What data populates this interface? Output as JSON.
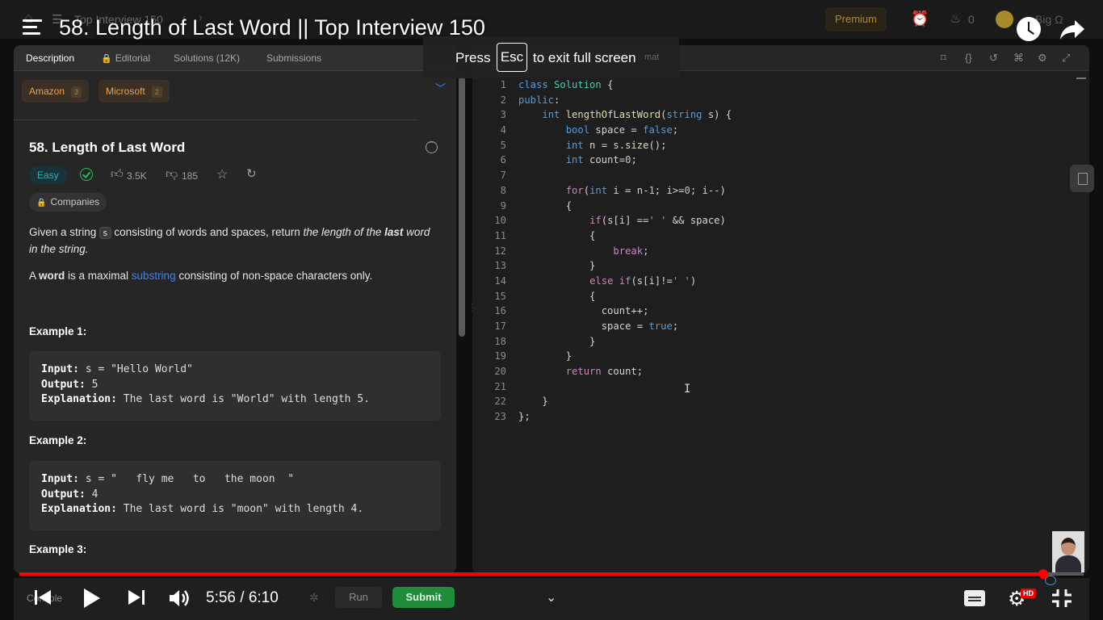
{
  "lc_top": {
    "problem_list": "Top Interview 150",
    "premium": "Premium",
    "streak": "0",
    "user": "Big Ω"
  },
  "video": {
    "title": "58. Length of Last Word || Top Interview 150",
    "current_time": "5:56",
    "duration": "6:10",
    "time_display": "5:56 / 6:10",
    "progress": 0.962,
    "quality_badge": "HD",
    "progress_color": "#ff0000"
  },
  "toast": {
    "press": "Press",
    "key": "Esc",
    "rest": "to exit full screen",
    "ghost": "mat"
  },
  "tabs": [
    {
      "label": "Description"
    },
    {
      "label": "Editorial"
    },
    {
      "label": "Solutions (12K)"
    },
    {
      "label": "Submissions"
    }
  ],
  "companies_chips": [
    {
      "name": "Amazon",
      "count": "3"
    },
    {
      "name": "Microsoft",
      "count": "2"
    }
  ],
  "problem": {
    "title": "58. Length of Last Word",
    "difficulty": "Easy",
    "likes": "3.5K",
    "dislikes": "185",
    "companies_label": "Companies",
    "desc1_a": "Given a string ",
    "desc1_code": "s",
    "desc1_b": " consisting of words and spaces, return ",
    "desc1_c": "the length of the ",
    "desc1_bold": "last",
    "desc1_d": " word in the string.",
    "desc2_a": "A ",
    "desc2_bold": "word",
    "desc2_b": " is a maximal ",
    "desc2_link": "substring",
    "desc2_c": " consisting of non-space characters only."
  },
  "examples": [
    {
      "title": "Example 1:",
      "input_label": "Input:",
      "input": " s = \"Hello World\"",
      "output_label": "Output:",
      "output": " 5",
      "explanation_label": "Explanation:",
      "explanation": " The last word is \"World\" with length 5."
    },
    {
      "title": "Example 2:",
      "input_label": "Input:",
      "input": " s = \"   fly me   to   the moon  \"",
      "output_label": "Output:",
      "output": " 4",
      "explanation_label": "Explanation:",
      "explanation": " The last word is \"moon\" with length 4."
    },
    {
      "title": "Example 3:"
    }
  ],
  "code_lines": [
    "1",
    "2",
    "3",
    "4",
    "5",
    "6",
    "7",
    "8",
    "9",
    "10",
    "11",
    "12",
    "13",
    "14",
    "15",
    "16",
    "17",
    "18",
    "19",
    "20",
    "21",
    "22",
    "23"
  ],
  "bottom": {
    "console": "Console",
    "run": "Run",
    "submit": "Submit"
  },
  "colors": {
    "accent_green": "#2cbb5d",
    "easy": "#1cb8b8",
    "link": "#3b82f6",
    "premium": "#b38630"
  }
}
